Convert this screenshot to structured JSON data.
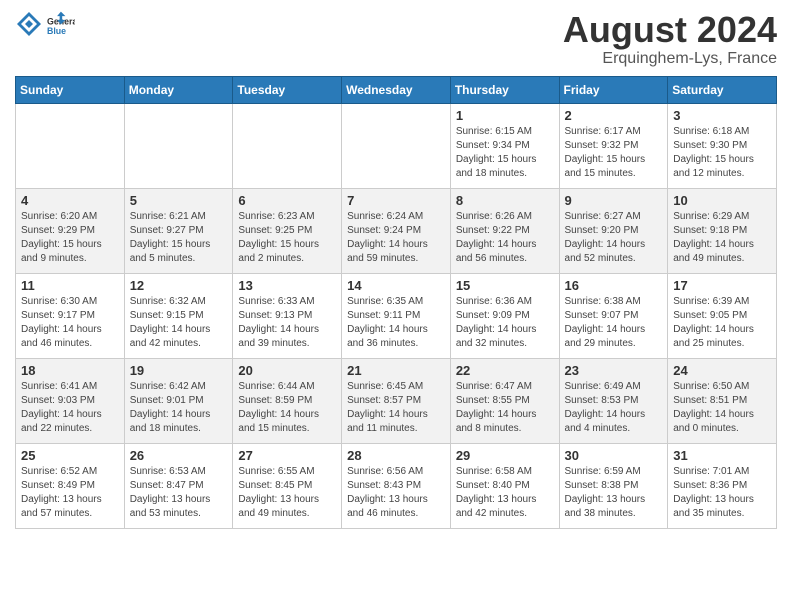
{
  "logo": {
    "general": "General",
    "blue": "Blue"
  },
  "title": "August 2024",
  "location": "Erquinghem-Lys, France",
  "days_of_week": [
    "Sunday",
    "Monday",
    "Tuesday",
    "Wednesday",
    "Thursday",
    "Friday",
    "Saturday"
  ],
  "weeks": [
    [
      {
        "day": "",
        "info": ""
      },
      {
        "day": "",
        "info": ""
      },
      {
        "day": "",
        "info": ""
      },
      {
        "day": "",
        "info": ""
      },
      {
        "day": "1",
        "info": "Sunrise: 6:15 AM\nSunset: 9:34 PM\nDaylight: 15 hours\nand 18 minutes."
      },
      {
        "day": "2",
        "info": "Sunrise: 6:17 AM\nSunset: 9:32 PM\nDaylight: 15 hours\nand 15 minutes."
      },
      {
        "day": "3",
        "info": "Sunrise: 6:18 AM\nSunset: 9:30 PM\nDaylight: 15 hours\nand 12 minutes."
      }
    ],
    [
      {
        "day": "4",
        "info": "Sunrise: 6:20 AM\nSunset: 9:29 PM\nDaylight: 15 hours\nand 9 minutes."
      },
      {
        "day": "5",
        "info": "Sunrise: 6:21 AM\nSunset: 9:27 PM\nDaylight: 15 hours\nand 5 minutes."
      },
      {
        "day": "6",
        "info": "Sunrise: 6:23 AM\nSunset: 9:25 PM\nDaylight: 15 hours\nand 2 minutes."
      },
      {
        "day": "7",
        "info": "Sunrise: 6:24 AM\nSunset: 9:24 PM\nDaylight: 14 hours\nand 59 minutes."
      },
      {
        "day": "8",
        "info": "Sunrise: 6:26 AM\nSunset: 9:22 PM\nDaylight: 14 hours\nand 56 minutes."
      },
      {
        "day": "9",
        "info": "Sunrise: 6:27 AM\nSunset: 9:20 PM\nDaylight: 14 hours\nand 52 minutes."
      },
      {
        "day": "10",
        "info": "Sunrise: 6:29 AM\nSunset: 9:18 PM\nDaylight: 14 hours\nand 49 minutes."
      }
    ],
    [
      {
        "day": "11",
        "info": "Sunrise: 6:30 AM\nSunset: 9:17 PM\nDaylight: 14 hours\nand 46 minutes."
      },
      {
        "day": "12",
        "info": "Sunrise: 6:32 AM\nSunset: 9:15 PM\nDaylight: 14 hours\nand 42 minutes."
      },
      {
        "day": "13",
        "info": "Sunrise: 6:33 AM\nSunset: 9:13 PM\nDaylight: 14 hours\nand 39 minutes."
      },
      {
        "day": "14",
        "info": "Sunrise: 6:35 AM\nSunset: 9:11 PM\nDaylight: 14 hours\nand 36 minutes."
      },
      {
        "day": "15",
        "info": "Sunrise: 6:36 AM\nSunset: 9:09 PM\nDaylight: 14 hours\nand 32 minutes."
      },
      {
        "day": "16",
        "info": "Sunrise: 6:38 AM\nSunset: 9:07 PM\nDaylight: 14 hours\nand 29 minutes."
      },
      {
        "day": "17",
        "info": "Sunrise: 6:39 AM\nSunset: 9:05 PM\nDaylight: 14 hours\nand 25 minutes."
      }
    ],
    [
      {
        "day": "18",
        "info": "Sunrise: 6:41 AM\nSunset: 9:03 PM\nDaylight: 14 hours\nand 22 minutes."
      },
      {
        "day": "19",
        "info": "Sunrise: 6:42 AM\nSunset: 9:01 PM\nDaylight: 14 hours\nand 18 minutes."
      },
      {
        "day": "20",
        "info": "Sunrise: 6:44 AM\nSunset: 8:59 PM\nDaylight: 14 hours\nand 15 minutes."
      },
      {
        "day": "21",
        "info": "Sunrise: 6:45 AM\nSunset: 8:57 PM\nDaylight: 14 hours\nand 11 minutes."
      },
      {
        "day": "22",
        "info": "Sunrise: 6:47 AM\nSunset: 8:55 PM\nDaylight: 14 hours\nand 8 minutes."
      },
      {
        "day": "23",
        "info": "Sunrise: 6:49 AM\nSunset: 8:53 PM\nDaylight: 14 hours\nand 4 minutes."
      },
      {
        "day": "24",
        "info": "Sunrise: 6:50 AM\nSunset: 8:51 PM\nDaylight: 14 hours\nand 0 minutes."
      }
    ],
    [
      {
        "day": "25",
        "info": "Sunrise: 6:52 AM\nSunset: 8:49 PM\nDaylight: 13 hours\nand 57 minutes."
      },
      {
        "day": "26",
        "info": "Sunrise: 6:53 AM\nSunset: 8:47 PM\nDaylight: 13 hours\nand 53 minutes."
      },
      {
        "day": "27",
        "info": "Sunrise: 6:55 AM\nSunset: 8:45 PM\nDaylight: 13 hours\nand 49 minutes."
      },
      {
        "day": "28",
        "info": "Sunrise: 6:56 AM\nSunset: 8:43 PM\nDaylight: 13 hours\nand 46 minutes."
      },
      {
        "day": "29",
        "info": "Sunrise: 6:58 AM\nSunset: 8:40 PM\nDaylight: 13 hours\nand 42 minutes."
      },
      {
        "day": "30",
        "info": "Sunrise: 6:59 AM\nSunset: 8:38 PM\nDaylight: 13 hours\nand 38 minutes."
      },
      {
        "day": "31",
        "info": "Sunrise: 7:01 AM\nSunset: 8:36 PM\nDaylight: 13 hours\nand 35 minutes."
      }
    ]
  ]
}
